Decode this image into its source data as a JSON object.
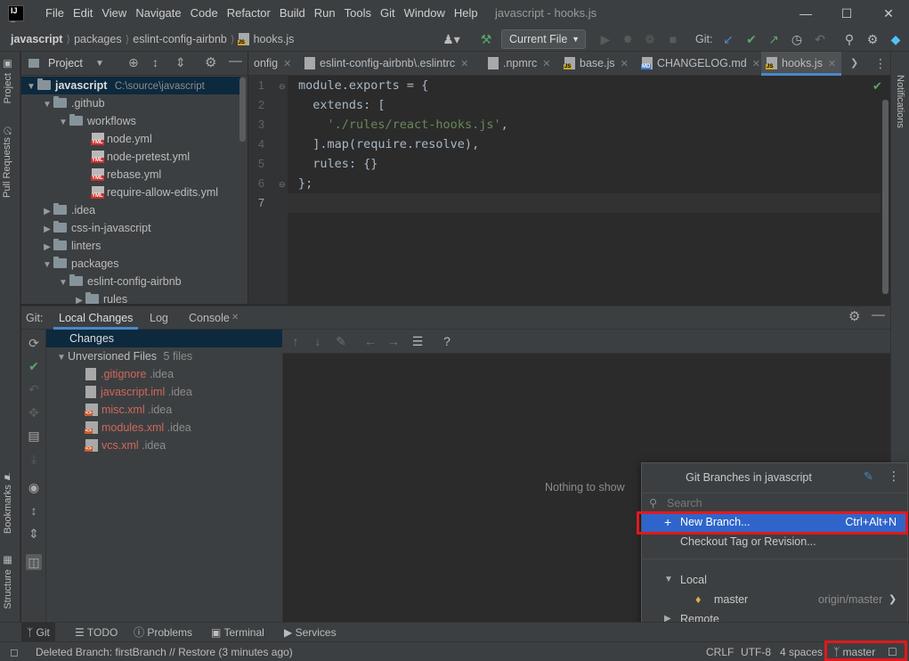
{
  "app": {
    "window_title": "javascript - hooks.js",
    "menu": [
      "File",
      "Edit",
      "View",
      "Navigate",
      "Code",
      "Refactor",
      "Build",
      "Run",
      "Tools",
      "Git",
      "Window",
      "Help"
    ]
  },
  "breadcrumbs": [
    "javascript",
    "packages",
    "eslint-config-airbnb",
    "hooks.js"
  ],
  "toolbar": {
    "run_config": "Current File",
    "git_label": "Git:"
  },
  "left_strip": {
    "project": "Project",
    "pull_requests": "Pull Requests",
    "bookmarks": "Bookmarks",
    "structure": "Structure"
  },
  "right_strip": {
    "notifications": "Notifications"
  },
  "project": {
    "header": "Project",
    "tree": [
      {
        "label": "javascript",
        "note": "C:\\source\\javascript"
      },
      {
        "label": ".github"
      },
      {
        "label": "workflows"
      },
      {
        "label": "node.yml"
      },
      {
        "label": "node-pretest.yml"
      },
      {
        "label": "rebase.yml"
      },
      {
        "label": "require-allow-edits.yml"
      },
      {
        "label": ".idea"
      },
      {
        "label": "css-in-javascript"
      },
      {
        "label": "linters"
      },
      {
        "label": "packages"
      },
      {
        "label": "eslint-config-airbnb"
      },
      {
        "label": "rules"
      }
    ]
  },
  "editor": {
    "tabs": [
      "onfig",
      "eslint-config-airbnb\\.eslintrc",
      ".npmrc",
      "base.js",
      "CHANGELOG.md",
      "hooks.js"
    ],
    "line_numbers": [
      "1",
      "2",
      "3",
      "4",
      "5",
      "6",
      "7"
    ],
    "code": {
      "l1": "module.exports = {",
      "l2": "  extends: [",
      "l3_str": "'./rules/react-hooks.js'",
      "l3_end": ",",
      "l4": "  ].map(require.resolve),",
      "l5": "  rules: {}",
      "l6": "};"
    }
  },
  "git_panel": {
    "label": "Git:",
    "tabs": [
      "Local Changes",
      "Log",
      "Console"
    ],
    "changes_title": "Changes",
    "unversioned": {
      "label": "Unversioned Files",
      "count": "5 files"
    },
    "files": [
      {
        "name": ".gitignore",
        "dir": ".idea"
      },
      {
        "name": "javascript.iml",
        "dir": ".idea"
      },
      {
        "name": "misc.xml",
        "dir": ".idea"
      },
      {
        "name": "modules.xml",
        "dir": ".idea"
      },
      {
        "name": "vcs.xml",
        "dir": ".idea"
      }
    ],
    "empty_text": "Nothing to show",
    "help": "?"
  },
  "branch_popup": {
    "title": "Git Branches in javascript",
    "search_placeholder": "Search",
    "new_branch": "New Branch...",
    "new_branch_shortcut": "Ctrl+Alt+N",
    "checkout_tag": "Checkout Tag or Revision...",
    "local": "Local",
    "local_branch": "master",
    "local_branch_tracking": "origin/master",
    "remote": "Remote"
  },
  "bottom_tools": [
    "Git",
    "TODO",
    "Problems",
    "Terminal",
    "Services"
  ],
  "status": {
    "message": "Deleted Branch: firstBranch // Restore (3 minutes ago)",
    "line_sep": "CRLF",
    "encoding": "UTF-8",
    "indent": "4 spaces",
    "branch": "master"
  },
  "colors": {
    "accent": "#4a88c7",
    "selection": "#2f65ca",
    "highlight": "#e0191d",
    "unversioned": "#d1675a"
  }
}
